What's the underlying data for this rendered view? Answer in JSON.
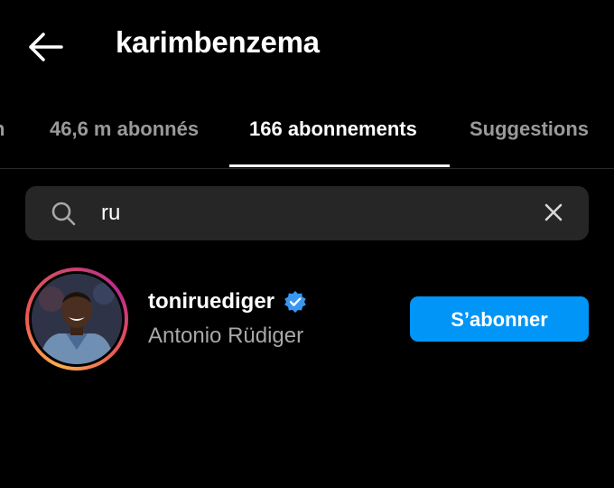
{
  "header": {
    "back_icon": "arrow-left-icon",
    "title": "karimbenzema"
  },
  "tabs": [
    {
      "label": "n",
      "active": false
    },
    {
      "label": "46,6 m abonnés",
      "active": false
    },
    {
      "label": "166 abonnements",
      "active": true
    },
    {
      "label": "Suggestions",
      "active": false
    }
  ],
  "search": {
    "icon": "search-icon",
    "value": "ru",
    "clear_icon": "close-icon"
  },
  "results": [
    {
      "username": "toniruediger",
      "verified": true,
      "full_name": "Antonio Rüdiger",
      "button_label": "S’abonner"
    }
  ],
  "colors": {
    "background": "#000000",
    "accent": "#0095f6",
    "search_bg": "#262626",
    "muted_text": "#a8a8a8"
  }
}
